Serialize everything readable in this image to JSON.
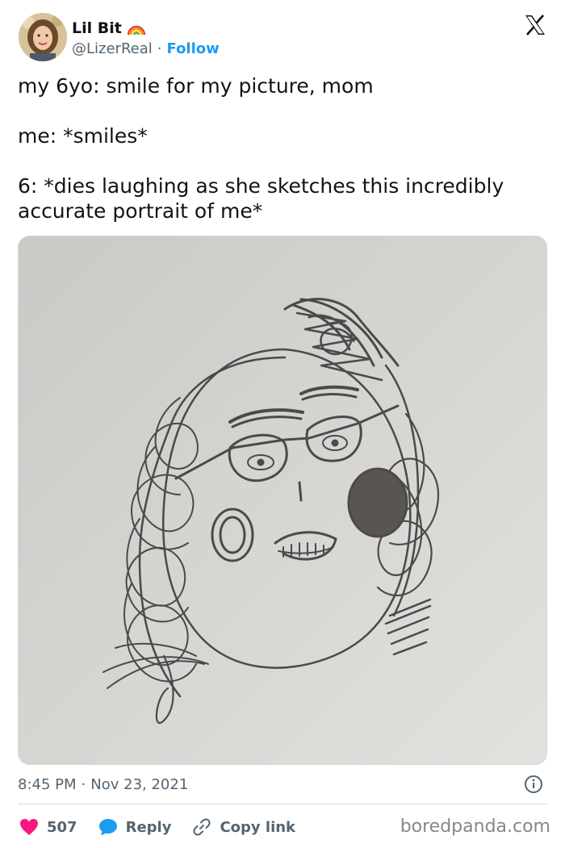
{
  "header": {
    "display_name": "Lil Bit",
    "handle": "@LizerReal",
    "separator": "·",
    "follow_label": "Follow"
  },
  "tweet": {
    "text": "my 6yo: smile for my picture, mom\n\nme: *smiles*\n\n6: *dies laughing as she sketches this incredibly\naccurate portrait of me*"
  },
  "meta": {
    "time": "8:45 PM",
    "separator": "·",
    "date": "Nov 23, 2021"
  },
  "actions": {
    "like_count": "507",
    "reply_label": "Reply",
    "copy_link_label": "Copy link"
  },
  "watermark": "boredpanda.com",
  "colors": {
    "accent": "#1d9bf0",
    "like": "#f91880",
    "muted": "#536471"
  },
  "icons": [
    "rainbow-icon",
    "x-logo-icon",
    "info-icon",
    "heart-icon",
    "reply-bubble-icon",
    "link-icon"
  ]
}
